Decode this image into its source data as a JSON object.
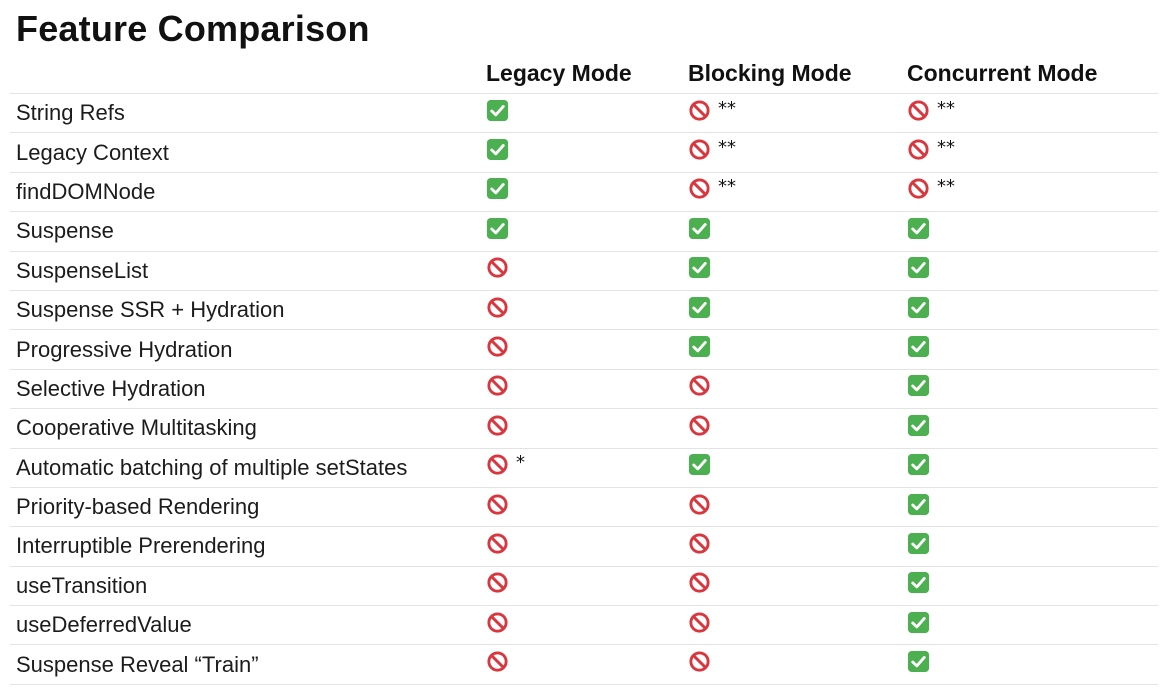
{
  "title": "Feature Comparison",
  "colors": {
    "check_green": "#4caf50",
    "no_red": "#d9363e"
  },
  "columns": [
    "",
    "Legacy Mode",
    "Blocking Mode",
    "Concurrent Mode"
  ],
  "rows": [
    {
      "feature": "String Refs",
      "cells": [
        {
          "icon": "check-icon",
          "note": ""
        },
        {
          "icon": "no-entry-icon",
          "note": "**"
        },
        {
          "icon": "no-entry-icon",
          "note": "**"
        }
      ]
    },
    {
      "feature": "Legacy Context",
      "cells": [
        {
          "icon": "check-icon",
          "note": ""
        },
        {
          "icon": "no-entry-icon",
          "note": "**"
        },
        {
          "icon": "no-entry-icon",
          "note": "**"
        }
      ]
    },
    {
      "feature": "findDOMNode",
      "cells": [
        {
          "icon": "check-icon",
          "note": ""
        },
        {
          "icon": "no-entry-icon",
          "note": "**"
        },
        {
          "icon": "no-entry-icon",
          "note": "**"
        }
      ]
    },
    {
      "feature": "Suspense",
      "cells": [
        {
          "icon": "check-icon",
          "note": ""
        },
        {
          "icon": "check-icon",
          "note": ""
        },
        {
          "icon": "check-icon",
          "note": ""
        }
      ]
    },
    {
      "feature": "SuspenseList",
      "cells": [
        {
          "icon": "no-entry-icon",
          "note": ""
        },
        {
          "icon": "check-icon",
          "note": ""
        },
        {
          "icon": "check-icon",
          "note": ""
        }
      ]
    },
    {
      "feature": "Suspense SSR + Hydration",
      "cells": [
        {
          "icon": "no-entry-icon",
          "note": ""
        },
        {
          "icon": "check-icon",
          "note": ""
        },
        {
          "icon": "check-icon",
          "note": ""
        }
      ]
    },
    {
      "feature": "Progressive Hydration",
      "cells": [
        {
          "icon": "no-entry-icon",
          "note": ""
        },
        {
          "icon": "check-icon",
          "note": ""
        },
        {
          "icon": "check-icon",
          "note": ""
        }
      ]
    },
    {
      "feature": "Selective Hydration",
      "cells": [
        {
          "icon": "no-entry-icon",
          "note": ""
        },
        {
          "icon": "no-entry-icon",
          "note": ""
        },
        {
          "icon": "check-icon",
          "note": ""
        }
      ]
    },
    {
      "feature": "Cooperative Multitasking",
      "cells": [
        {
          "icon": "no-entry-icon",
          "note": ""
        },
        {
          "icon": "no-entry-icon",
          "note": ""
        },
        {
          "icon": "check-icon",
          "note": ""
        }
      ]
    },
    {
      "feature": "Automatic batching of multiple setStates",
      "cells": [
        {
          "icon": "no-entry-icon",
          "note": "*"
        },
        {
          "icon": "check-icon",
          "note": ""
        },
        {
          "icon": "check-icon",
          "note": ""
        }
      ]
    },
    {
      "feature": "Priority-based Rendering",
      "cells": [
        {
          "icon": "no-entry-icon",
          "note": ""
        },
        {
          "icon": "no-entry-icon",
          "note": ""
        },
        {
          "icon": "check-icon",
          "note": ""
        }
      ]
    },
    {
      "feature": "Interruptible Prerendering",
      "cells": [
        {
          "icon": "no-entry-icon",
          "note": ""
        },
        {
          "icon": "no-entry-icon",
          "note": ""
        },
        {
          "icon": "check-icon",
          "note": ""
        }
      ]
    },
    {
      "feature": "useTransition",
      "cells": [
        {
          "icon": "no-entry-icon",
          "note": ""
        },
        {
          "icon": "no-entry-icon",
          "note": ""
        },
        {
          "icon": "check-icon",
          "note": ""
        }
      ]
    },
    {
      "feature": "useDeferredValue",
      "cells": [
        {
          "icon": "no-entry-icon",
          "note": ""
        },
        {
          "icon": "no-entry-icon",
          "note": ""
        },
        {
          "icon": "check-icon",
          "note": ""
        }
      ]
    },
    {
      "feature": "Suspense Reveal “Train”",
      "cells": [
        {
          "icon": "no-entry-icon",
          "note": ""
        },
        {
          "icon": "no-entry-icon",
          "note": ""
        },
        {
          "icon": "check-icon",
          "note": ""
        }
      ]
    }
  ]
}
